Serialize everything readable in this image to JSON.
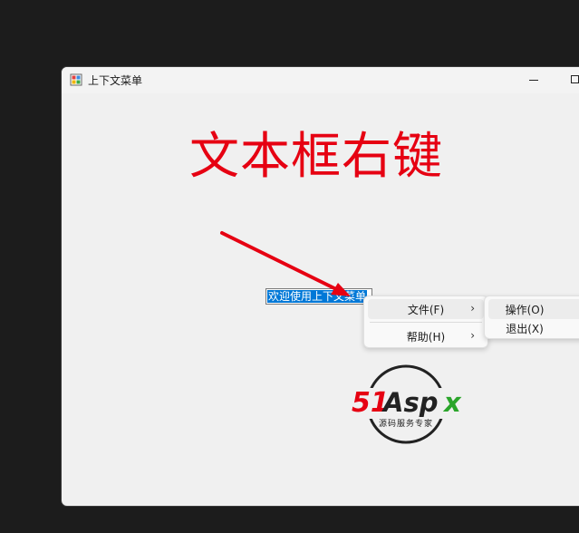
{
  "window": {
    "title": "上下文菜单",
    "icon": "winforms-app-icon"
  },
  "main": {
    "heading": "文本框右键",
    "heading_color": "#e60012",
    "textbox_value": "欢迎使用上下文菜单",
    "selection_color": "#0078d7"
  },
  "context_menu": {
    "items": [
      {
        "label": "文件(F)",
        "has_submenu": true
      },
      {
        "label": "帮助(H)",
        "has_submenu": true
      }
    ],
    "submenu_arrow": "›"
  },
  "submenu": {
    "items": [
      {
        "label": "操作(O)"
      },
      {
        "label": "退出(X)"
      }
    ]
  },
  "logo": {
    "brand": "51Aspx",
    "slogan": "源码服务专家"
  }
}
